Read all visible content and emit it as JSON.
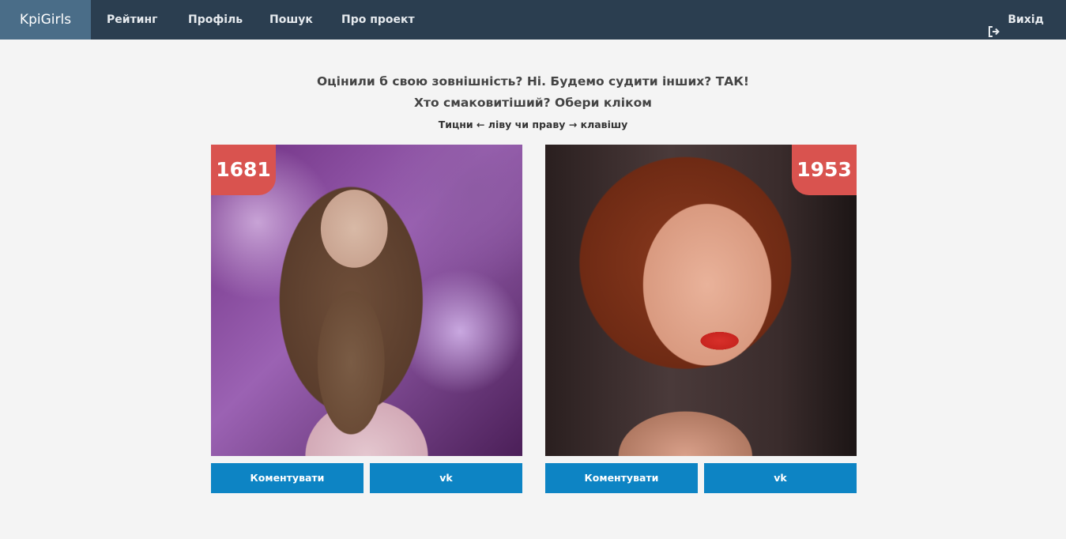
{
  "navbar": {
    "brand": "KpiGirls",
    "links": [
      "Рейтинг",
      "Профіль",
      "Пошук",
      "Про проект"
    ],
    "logout": {
      "icon": "sign-out-icon",
      "label": "Вихід"
    }
  },
  "intro": {
    "line1": "Оцінили б свою зовнішність? Ні. Будемо судити інших? ТАК!",
    "line2": "Хто смаковитіший? Обери кліком",
    "hint": "Тицни ← ліву чи праву → клавішу"
  },
  "cards": [
    {
      "score": "1681",
      "comment_label": "Коментувати",
      "vk_label": "vk"
    },
    {
      "score": "1953",
      "comment_label": "Коментувати",
      "vk_label": "vk"
    }
  ],
  "colors": {
    "navbar": "#2b3e50",
    "brand": "#4a6d88",
    "score_badge": "#d9534f",
    "button": "#0d84c4",
    "background": "#f4f4f4"
  }
}
